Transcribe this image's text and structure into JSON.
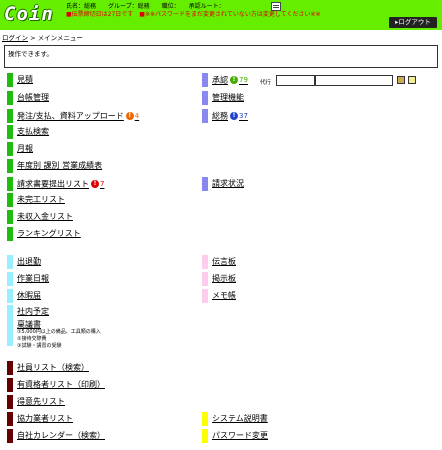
{
  "header": {
    "logo": "Coin",
    "user_info": "氏名：総務　　グループ：総務　　職位：　　承認ルート：",
    "notice": "■伝票締切日は27日です　■※※パスワードをまだ変更されていない方は変更してください※※",
    "logout_label": "▸ログアウト"
  },
  "breadcrumb": {
    "login_link": "ログイン",
    "sep": " > ",
    "current": "メインメニュー"
  },
  "message": "操作できます。",
  "proxy": {
    "label": "代行"
  },
  "menu": {
    "mitsumori": "見積",
    "daichou": "台帳管理",
    "hatchu": "発注/支払、資料アップロード",
    "hatchu_count": "4",
    "shiharai": "支払検索",
    "geppo": "月報",
    "nendo": "年度別 課別 営業成績表",
    "seikyu_list": "請求書要提出リスト",
    "seikyu_count": "7",
    "mikan": "未完工リスト",
    "mishu": "未収入金リスト",
    "ranking": "ランキングリスト",
    "shonin": "承認",
    "shonin_count": "79",
    "kanri": "管理機能",
    "sokatsu": "総務",
    "sokatsu_count": "37",
    "seikyu_jokyo": "請求状況",
    "shuttaikin": "出退勤",
    "sagyo": "作業日報",
    "kyuka": "休暇届",
    "shanai": "社内予定",
    "ringi": "稟議書",
    "ringi_note1": "①5,000円以上の備品、工具類の購入",
    "ringi_note2": "②接待交際費",
    "ringi_note3": "③試験・講習の受験",
    "dengon": "伝言板",
    "keijiban": "掲示板",
    "memo": "メモ帳",
    "shain": "社員リスト（検索）",
    "shikaku": "有資格者リスト（印刷）",
    "tokuisaki": "得意先リスト",
    "kyoryoku": "協力業者リスト",
    "calendar": "自社カレンダー（検索）",
    "system": "システム説明書",
    "password": "パスワード変更"
  },
  "colors": {
    "header_bg": "#66ee00",
    "green": "#22bb11",
    "purple": "#8888ee",
    "cyan": "#99eeff",
    "pink": "#ffccee",
    "maroon": "#660000",
    "yellow": "#ffff00",
    "badge_orange": "#ee6600",
    "badge_red": "#dd0000",
    "badge_green": "#44aa00",
    "badge_blue": "#2244cc"
  }
}
